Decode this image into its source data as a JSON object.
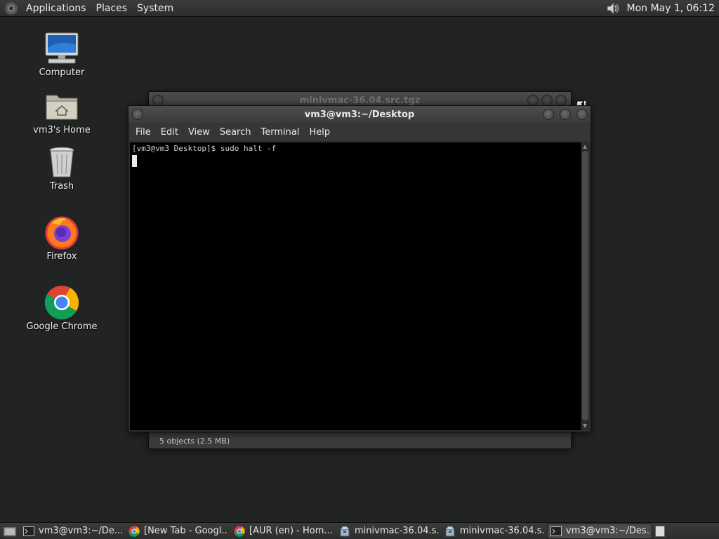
{
  "top_panel": {
    "menus": [
      "Applications",
      "Places",
      "System"
    ],
    "clock": "Mon May  1, 06:12"
  },
  "desktop_icons": [
    {
      "label": "Computer",
      "icon": "computer-icon"
    },
    {
      "label": "vm3's Home",
      "icon": "home-folder-icon"
    },
    {
      "label": "Trash",
      "icon": "trash-icon"
    },
    {
      "label": "Firefox",
      "icon": "firefox-icon"
    },
    {
      "label": "Google Chrome",
      "icon": "chrome-icon"
    }
  ],
  "back_window": {
    "title": "minivmac-36.04.src.tgz",
    "status": "5 objects (2.5 MB)"
  },
  "terminal_window": {
    "title": "vm3@vm3:~/Desktop",
    "menus": [
      "File",
      "Edit",
      "View",
      "Search",
      "Terminal",
      "Help"
    ],
    "prompt_line": "[vm3@vm3 Desktop]$ sudo halt -f"
  },
  "taskbar": {
    "tasks": [
      {
        "label": "vm3@vm3:~/De...",
        "icon": "terminal-icon",
        "active": false
      },
      {
        "label": "[New Tab - Googl...",
        "icon": "chrome-icon",
        "active": false
      },
      {
        "label": "[AUR (en) - Hom...",
        "icon": "chrome-icon",
        "active": false
      },
      {
        "label": "minivmac-36.04.s...",
        "icon": "archive-manager-icon",
        "active": false
      },
      {
        "label": "minivmac-36.04.s...",
        "icon": "archive-manager-icon",
        "active": false
      },
      {
        "label": "vm3@vm3:~/Des...",
        "icon": "terminal-icon",
        "active": true
      }
    ]
  },
  "colors": {
    "desktop_bg": "#222323",
    "panel_bg": "#333434",
    "terminal_bg": "#000000"
  }
}
